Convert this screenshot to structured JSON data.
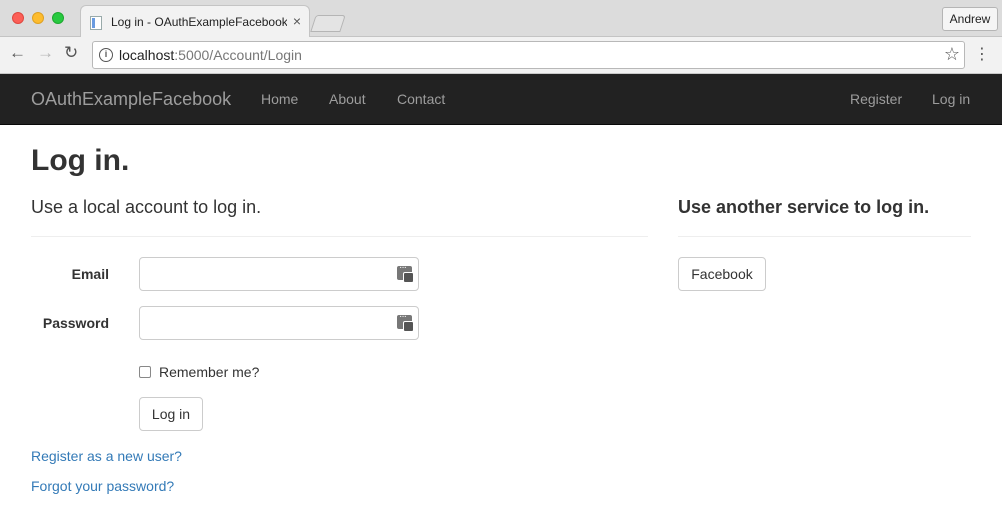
{
  "browser": {
    "tab_title": "Log in - OAuthExampleFacebook",
    "tab_close": "×",
    "profile_name": "Andrew",
    "url_host": "localhost",
    "url_path": ":5000/Account/Login",
    "icons": {
      "back": "←",
      "forward": "→",
      "reload": "↻",
      "info": "i",
      "star": "☆",
      "menu": "⋮"
    }
  },
  "navbar": {
    "brand": "OAuthExampleFacebook",
    "links": [
      "Home",
      "About",
      "Contact"
    ],
    "right_links": [
      "Register",
      "Log in"
    ]
  },
  "page": {
    "title": "Log in.",
    "local_heading": "Use a local account to log in.",
    "other_heading": "Use another service to log in.",
    "email_label": "Email",
    "email_value": "",
    "password_label": "Password",
    "password_value": "",
    "remember_label": "Remember me?",
    "remember_checked": false,
    "login_button": "Log in",
    "external_button": "Facebook",
    "register_link": "Register as a new user?",
    "forgot_link": "Forgot your password?"
  },
  "colors": {
    "navbar_bg": "#222222",
    "navbar_text": "#9d9d9d",
    "link": "#337ab7"
  }
}
